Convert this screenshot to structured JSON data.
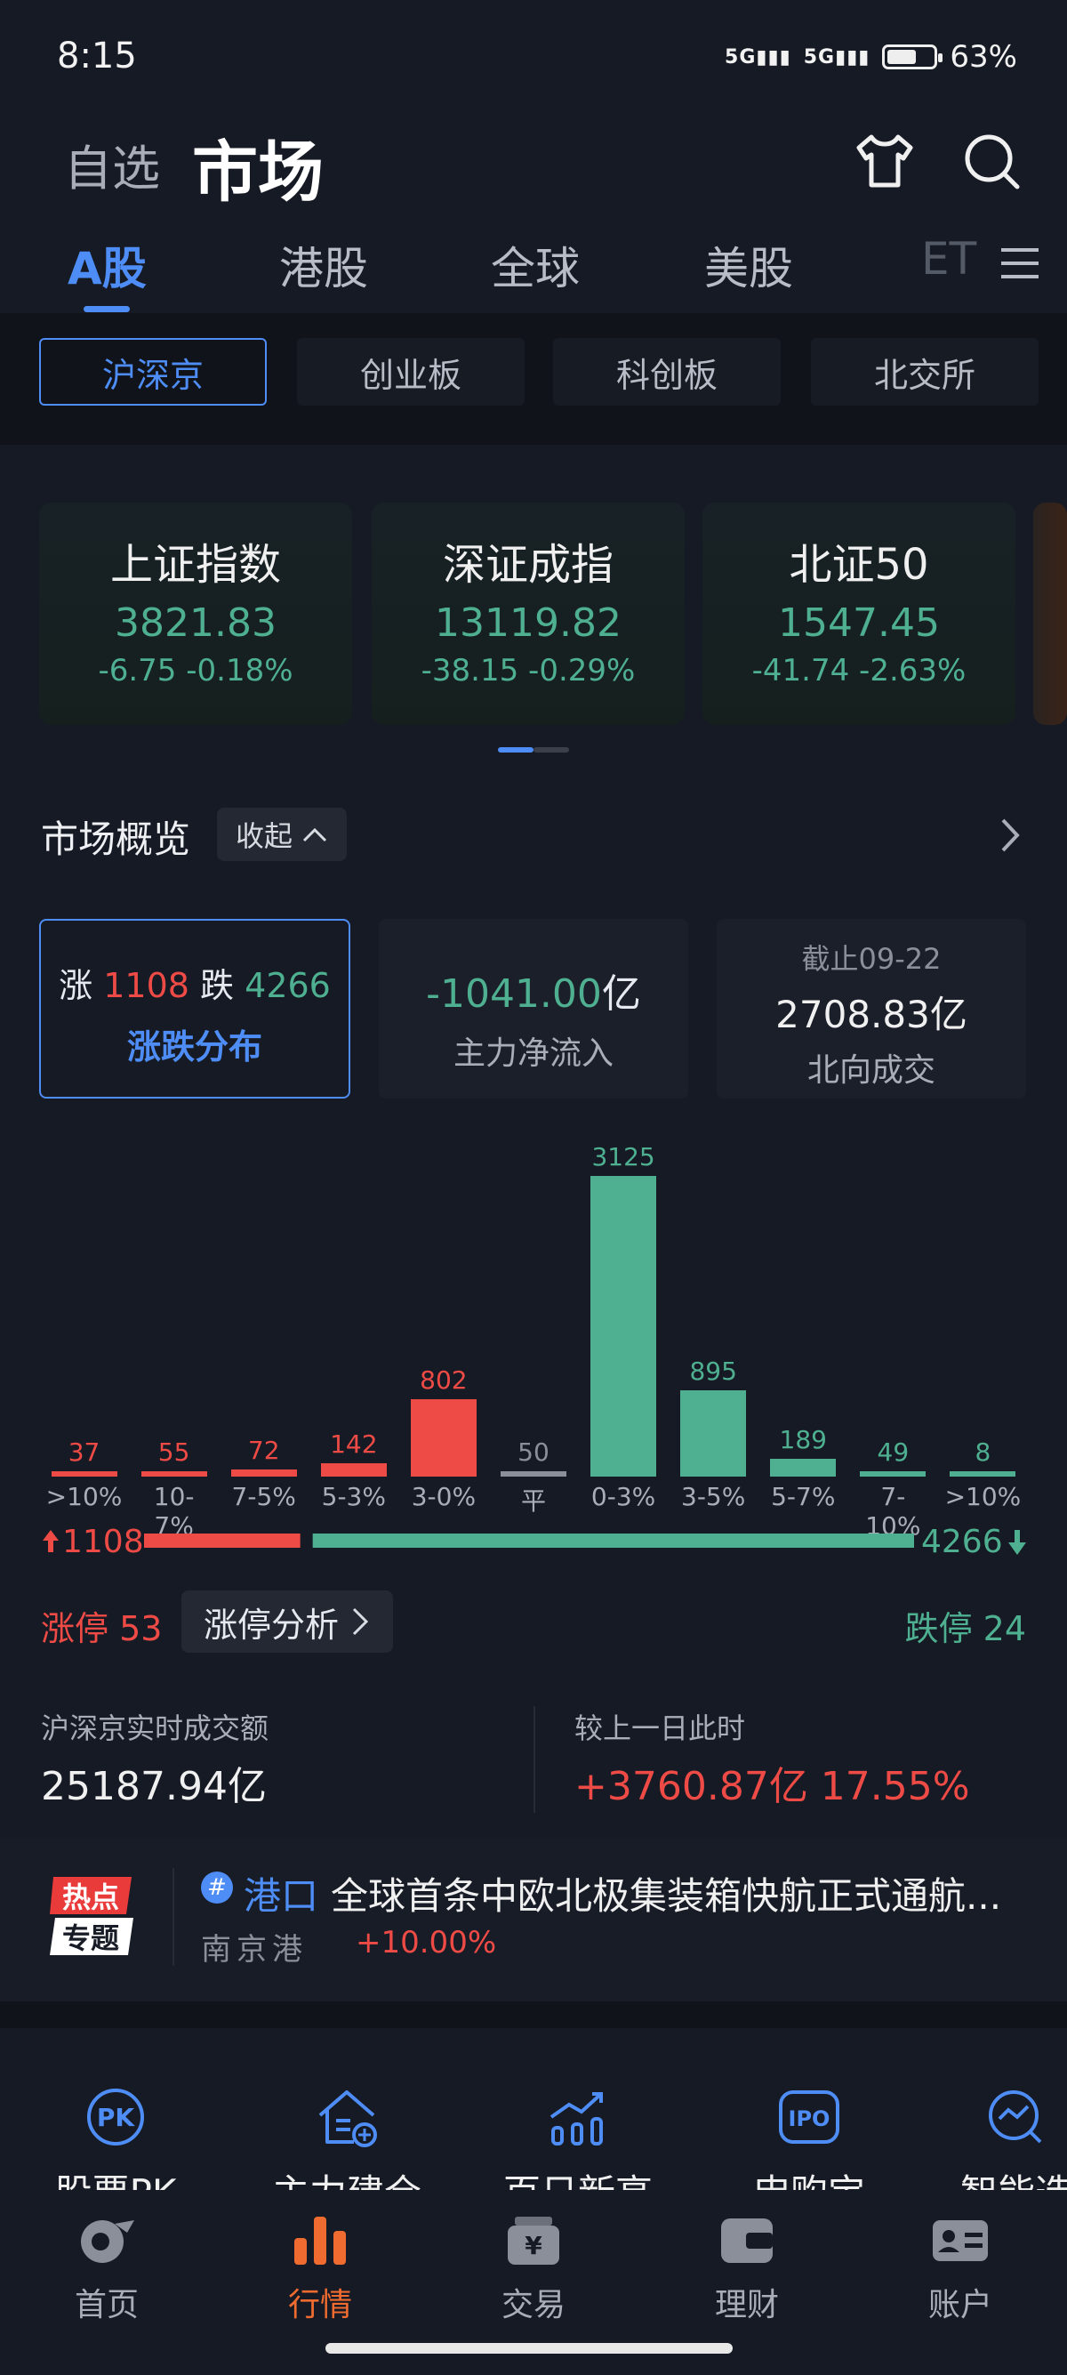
{
  "status": {
    "time": "8:15",
    "signal1": "5G",
    "signal2": "5G",
    "battery": "63%",
    "battery_level": 0.63
  },
  "top_nav": {
    "watchlist": "自选",
    "market": "市场"
  },
  "main_tabs": [
    "A股",
    "港股",
    "全球",
    "美股",
    "ET"
  ],
  "sub_tabs": [
    "沪深京",
    "创业板",
    "科创板",
    "北交所"
  ],
  "indices": [
    {
      "name": "上证指数",
      "value": "3821.83",
      "change": "-6.75 -0.18%"
    },
    {
      "name": "深证成指",
      "value": "13119.82",
      "change": "-38.15 -0.29%"
    },
    {
      "name": "北证50",
      "value": "1547.45",
      "change": "-41.74 -2.63%"
    }
  ],
  "overview": {
    "title": "市场概览",
    "collapse": "收起",
    "updown": {
      "up_label": "涨",
      "up_count": "1108",
      "down_label": "跌",
      "down_count": "4266",
      "caption": "涨跌分布"
    },
    "net_inflow": {
      "value": "-1041.00",
      "unit": "亿",
      "caption": "主力净流入"
    },
    "north": {
      "date": "截止09-22",
      "value": "2708.83亿",
      "caption": "北向成交"
    }
  },
  "chart_data": {
    "type": "bar",
    "categories": [
      ">10%",
      "10-7%",
      "7-5%",
      "5-3%",
      "3-0%",
      "平",
      "0-3%",
      "3-5%",
      "5-7%",
      "7-10%",
      ">10%"
    ],
    "values": [
      37,
      55,
      72,
      142,
      802,
      50,
      3125,
      895,
      189,
      49,
      8
    ],
    "colors": [
      "#ef4b46",
      "#ef4b46",
      "#ef4b46",
      "#ef4b46",
      "#ef4b46",
      "#8a8f99",
      "#4eb090",
      "#4eb090",
      "#4eb090",
      "#4eb090",
      "#4eb090"
    ],
    "ylim": [
      0,
      3125
    ]
  },
  "ratio": {
    "up": "1108",
    "down": "4266",
    "up_value": 1108,
    "down_value": 4266
  },
  "limits": {
    "up_label": "涨停 53",
    "analysis": "涨停分析",
    "down_label": "跌停 24"
  },
  "turnover": {
    "label": "沪深京实时成交额",
    "value": "25187.94亿",
    "compare_label": "较上一日此时",
    "compare_value": "+3760.87亿 17.55%"
  },
  "hot": {
    "badge_line1": "热点",
    "badge_line2": "专题",
    "tag_icon": "#",
    "tag": "港口",
    "title": "全球首条中欧北极集装箱快航正式通航...",
    "stock": "南京港",
    "pct": "+10.00%"
  },
  "quick_links": [
    "股票PK",
    "主力建仓",
    "百日新高",
    "申购宝",
    "智能选"
  ],
  "bottom_nav": [
    "首页",
    "行情",
    "交易",
    "理财",
    "账户"
  ],
  "colors": {
    "accent": "#4e8df5",
    "up": "#ef4b46",
    "down": "#4eb090",
    "active_nav": "#f06b30",
    "bg": "#161a24"
  }
}
